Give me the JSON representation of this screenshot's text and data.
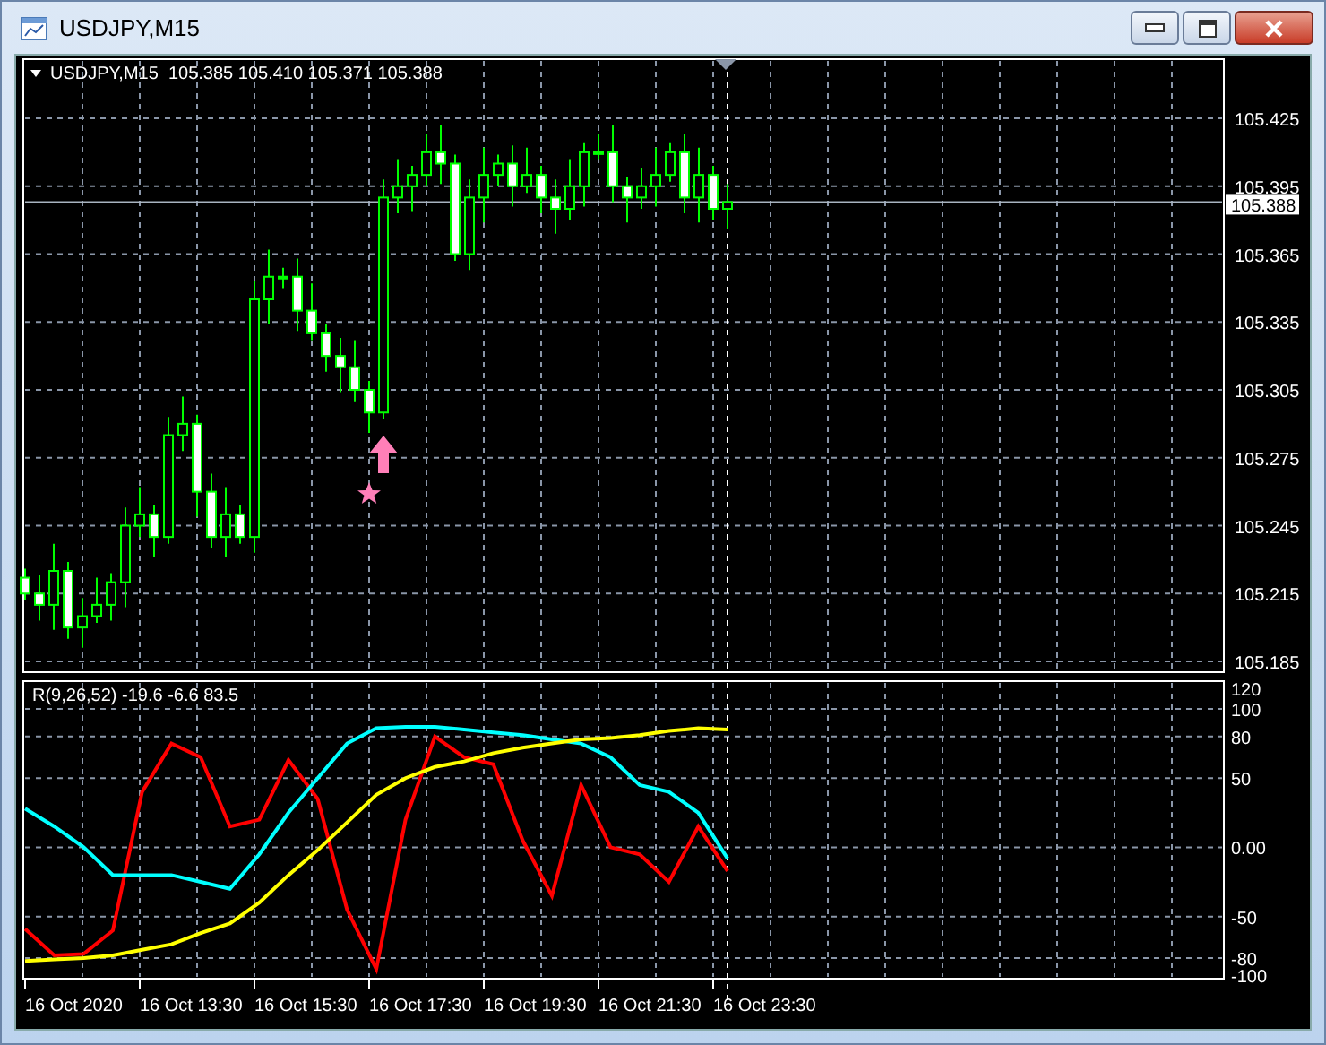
{
  "window": {
    "title": "USDJPY,M15"
  },
  "main_chart": {
    "header": "USDJPY,M15  105.385 105.410 105.371 105.388",
    "price_axis": [
      "105.425",
      "105.395",
      "105.365",
      "105.335",
      "105.305",
      "105.275",
      "105.245",
      "105.215",
      "105.185"
    ],
    "current_price": "105.388"
  },
  "indicator": {
    "label": "R(9,26,52) -19.6 -6.6 83.5",
    "chart_data": {
      "type": "line",
      "grid": true,
      "ylim": [
        -100,
        120
      ],
      "yticks": [
        120,
        100,
        80,
        50,
        {
          "value": 0,
          "label": "0.00"
        },
        -50,
        -80,
        -100
      ],
      "series": [
        {
          "color": "#ff0000",
          "values": [
            -59,
            -78,
            -77,
            -60,
            40,
            75,
            65,
            15,
            20,
            63,
            35,
            -45,
            -88,
            20,
            80,
            65,
            60,
            5,
            -35,
            45,
            0,
            -5,
            -25,
            15,
            -17
          ]
        },
        {
          "color": "#00ffff",
          "values": [
            28,
            15,
            0,
            -20,
            -20,
            -20,
            -25,
            -30,
            -5,
            25,
            50,
            75,
            86,
            87,
            87,
            85,
            83,
            81,
            78,
            75,
            65,
            45,
            40,
            25,
            -8
          ]
        },
        {
          "color": "#ffff00",
          "values": [
            -82,
            -81,
            -80,
            -78,
            -74,
            -70,
            -62,
            -55,
            -40,
            -20,
            -2,
            18,
            38,
            50,
            58,
            62,
            68,
            72,
            75,
            78,
            79,
            81,
            84,
            86,
            85
          ]
        }
      ]
    }
  },
  "time_axis": [
    "16 Oct 2020",
    "16 Oct 13:30",
    "16 Oct 15:30",
    "16 Oct 17:30",
    "16 Oct 19:30",
    "16 Oct 21:30",
    "16 Oct 23:30"
  ]
}
